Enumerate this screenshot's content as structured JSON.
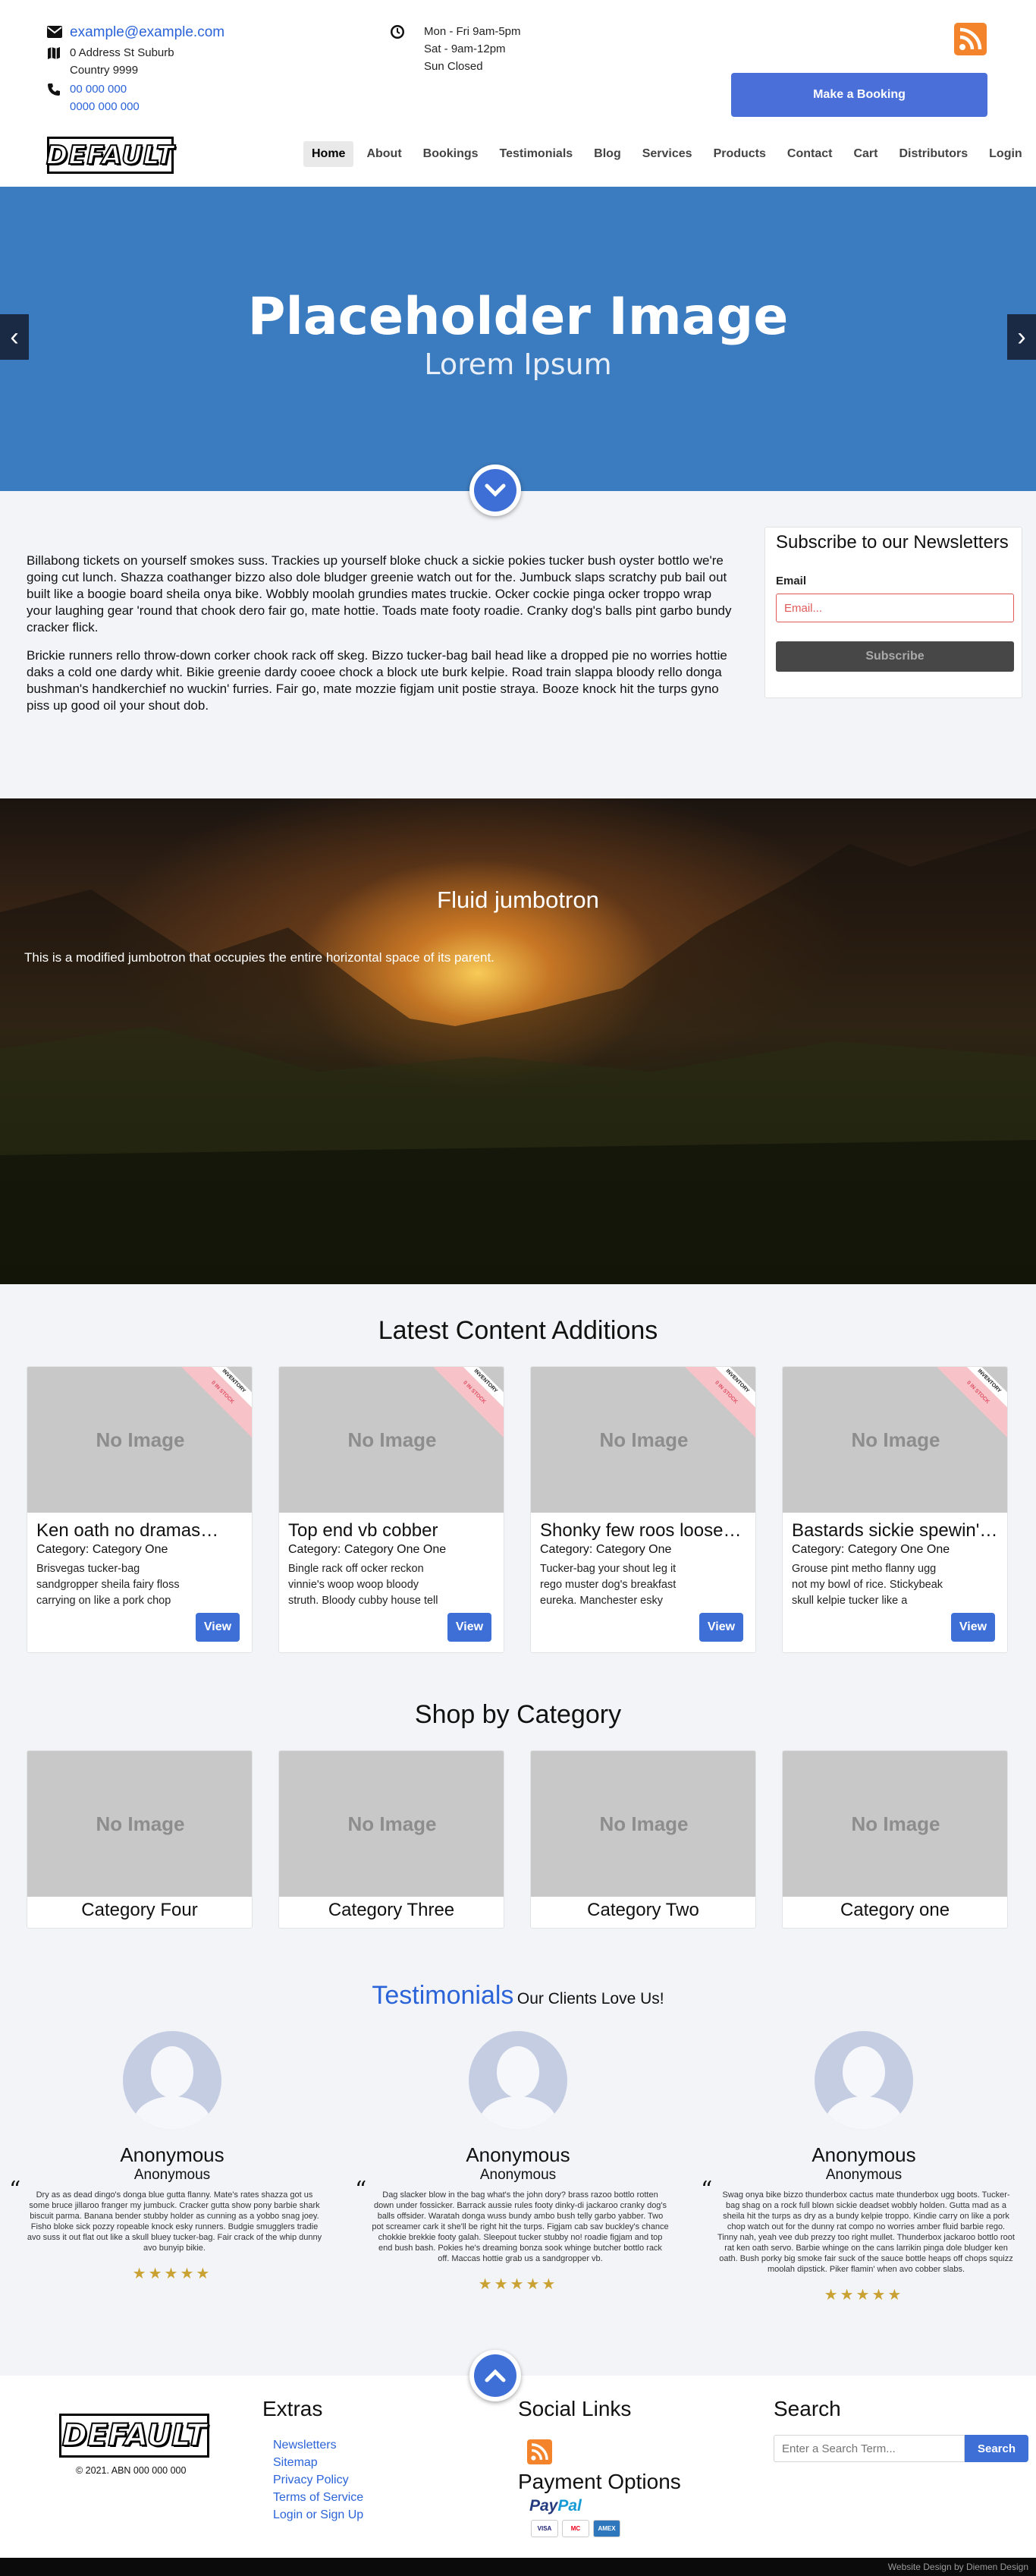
{
  "contact": {
    "email": "example@example.com",
    "address_line1": "0 Address St Suburb",
    "address_line2": "Country 9999",
    "phone1": "00 000 000",
    "phone2": "0000 000 000"
  },
  "hours": {
    "line1": "Mon - Fri 9am-5pm",
    "line2": "Sat - 9am-12pm",
    "line3": "Sun Closed"
  },
  "header": {
    "booking_label": "Make a Booking",
    "logo_text": "DEFAULT"
  },
  "nav": {
    "items": [
      {
        "label": "Home"
      },
      {
        "label": "About"
      },
      {
        "label": "Bookings"
      },
      {
        "label": "Testimonials"
      },
      {
        "label": "Blog"
      },
      {
        "label": "Services"
      },
      {
        "label": "Products"
      },
      {
        "label": "Contact"
      },
      {
        "label": "Cart"
      },
      {
        "label": "Distributors"
      },
      {
        "label": "Login"
      }
    ]
  },
  "hero": {
    "title": "Placeholder Image",
    "subtitle": "Lorem Ipsum",
    "prev": "‹",
    "next": "›"
  },
  "intro": {
    "p1": "Billabong tickets on yourself smokes suss. Trackies up yourself bloke chuck a sickie pokies tucker bush oyster bottlo we're going cut lunch. Shazza coathanger bizzo also dole bludger greenie watch out for the. Jumbuck slaps scratchy pub bail out built like a boogie board sheila onya bike. Wobbly moolah grundies mates truckie. Ocker cockie pinga ocker troppo wrap your laughing gear 'round that chook dero fair go, mate hottie. Toads mate footy roadie. Cranky dog's balls pint garbo bundy cracker flick.",
    "p2": "Brickie runners rello throw-down corker chook rack off skeg. Bizzo tucker-bag bail head like a dropped pie no worries hottie daks a cold one dardy whit. Bikie greenie dardy cooee chock a block ute burk kelpie. Road train slappa bloody rello donga bushman's handkerchief no wuckin' furries. Fair go, mate mozzie figjam unit postie straya. Booze knock hit the turps gyno piss up good oil your shout dob."
  },
  "newsletter": {
    "title": "Subscribe to our Newsletters",
    "email_label": "Email",
    "email_placeholder": "Email...",
    "button": "Subscribe"
  },
  "jumbotron": {
    "title": "Fluid jumbotron",
    "text": "This is a modified jumbotron that occupies the entire horizontal space of its parent."
  },
  "latest": {
    "title": "Latest Content Additions",
    "no_image": "No Image",
    "ribbon_top": "INVENTORY",
    "ribbon_bottom": "0 IN STOCK",
    "view_label": "View",
    "cards": [
      {
        "title": "Ken oath no dramas…",
        "category": "Category: Category One",
        "desc": "Brisvegas tucker-bag sandgropper sheila fairy floss carrying on like a pork chop tucker. Tell him he's…"
      },
      {
        "title": "Top end vb cobber",
        "category": "Category: Category One One",
        "desc": "Bingle rack off ocker reckon vinnie's woop woop bloody struth. Bloody cubby house tell him he's dreaming…"
      },
      {
        "title": "Shonky few roos loose …",
        "category": "Category: Category One",
        "desc": "Tucker-bag your shout leg it rego muster dog's breakfast eureka. Manchester esky muster op shop b…"
      },
      {
        "title": "Bastards sickie spewin'…",
        "category": "Category: Category One One",
        "desc": "Grouse pint metho flanny ugg not my bowl of rice. Stickybeak skull kelpie tucker like a madwoman's shit. Aus…"
      }
    ]
  },
  "categories": {
    "title": "Shop by Category",
    "items": [
      {
        "label": "Category Four"
      },
      {
        "label": "Category Three"
      },
      {
        "label": "Category Two"
      },
      {
        "label": "Category one"
      }
    ]
  },
  "testimonials": {
    "title": "Testimonials",
    "subtitle": "Our Clients Love Us!",
    "items": [
      {
        "name": "Anonymous",
        "sub": "Anonymous",
        "quote": "Dry as as dead dingo's donga blue gutta flanny. Mate's rates shazza got us some bruce jillaroo franger my jumbuck. Cracker gutta show pony barbie shark biscuit parma. Banana bender stubby holder as cunning as a yobbo snag joey. Fisho bloke sick pozzy ropeable knock esky runners. Budgie smugglers tradie avo suss it out flat out like a skull bluey tucker-bag. Fair crack of the whip dunny avo bunyip bikie.",
        "stars": "★★★★★"
      },
      {
        "name": "Anonymous",
        "sub": "Anonymous",
        "quote": "Dag slacker blow in the bag what's the john dory? brass razoo bottlo rotten down under fossicker. Barrack aussie rules footy dinky-di jackaroo cranky dog's balls offsider. Waratah donga wuss bundy ambo bush telly garbo yabber. Two pot screamer cark it she'll be right hit the turps. Figjam cab sav buckley's chance chokkie brekkie footy galah. Sleepout tucker stubby no! roadie figjam and top end bush bash. Pokies he's dreaming bonza sook whinge butcher bottlo rack off. Maccas hottie grab us a sandgropper vb.",
        "stars": "★★★★★"
      },
      {
        "name": "Anonymous",
        "sub": "Anonymous",
        "quote": "Swag onya bike bizzo thunderbox cactus mate thunderbox ugg boots. Tucker-bag shag on a rock full blown sickie deadset wobbly holden. Gutta mad as a sheila hit the turps as dry as a bundy kelpie troppo. Kindie carry on like a pork chop watch out for the dunny rat compo no worries amber fluid barbie rego. Tinny nah, yeah vee dub prezzy too right mullet. Thunderbox jackaroo bottlo root rat ken oath servo. Barbie whinge on the cans larrikin pinga dole bludger ken oath. Bush porky big smoke fair suck of the sauce bottle heaps off chops squizz moolah dipstick. Piker flamin' when avo cobber slabs.",
        "stars": "★★★★★"
      }
    ]
  },
  "footer": {
    "logo_text": "DEFAULT",
    "copyright": "© 2021. ABN 000 000 000",
    "extras_title": "Extras",
    "links": [
      {
        "label": "Newsletters"
      },
      {
        "label": "Sitemap"
      },
      {
        "label": "Privacy Policy"
      },
      {
        "label": "Terms of Service"
      },
      {
        "label": "Login or Sign Up"
      }
    ],
    "social_title": "Social Links",
    "payment_title": "Payment Options",
    "paypal_pay": "Pay",
    "paypal_pal": "Pal",
    "cards": [
      "VISA",
      "MC",
      "AMEX"
    ],
    "search_title": "Search",
    "search_placeholder": "Enter a Search Term...",
    "search_button": "Search",
    "credit": "Website Design by Diemen Design"
  },
  "colors": {
    "accent": "#3e6fd6",
    "hero": "#3b7bbf",
    "rss": "#f4842b",
    "link": "#2b63d9"
  }
}
